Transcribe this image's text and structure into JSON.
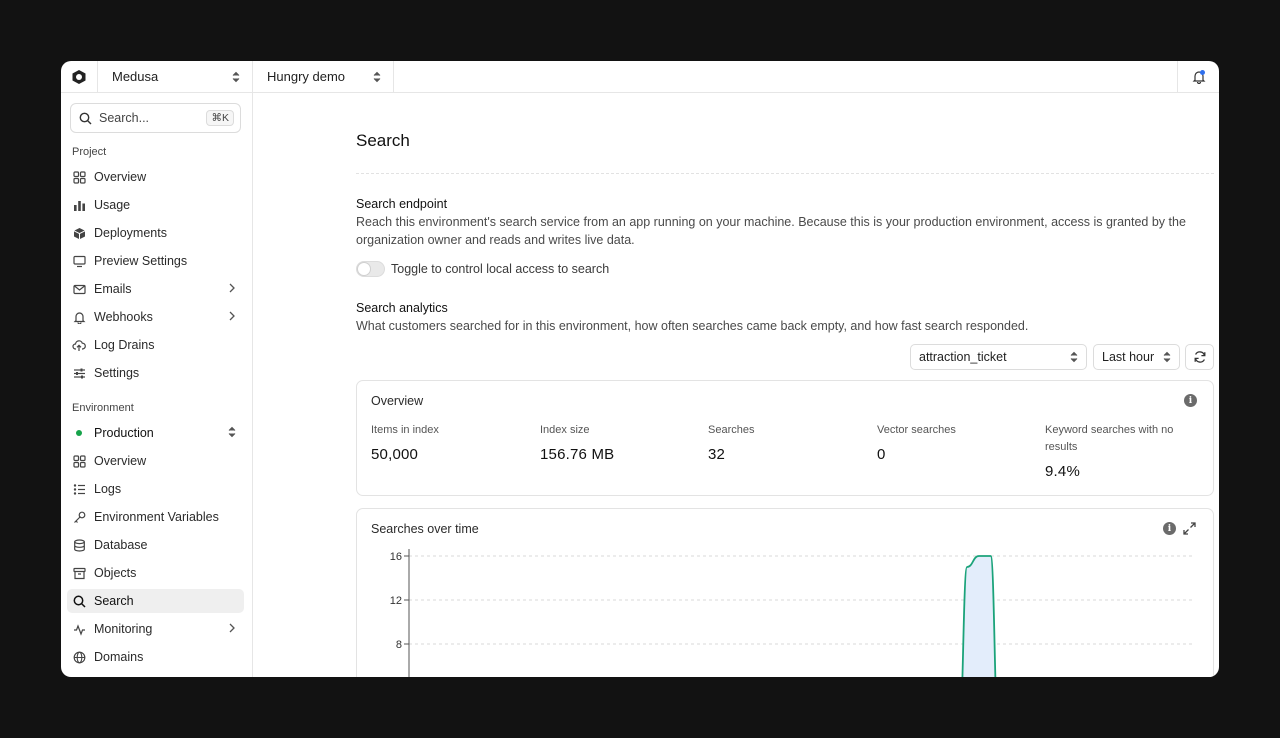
{
  "topbar": {
    "org_name": "Medusa",
    "project_name": "Hungry demo"
  },
  "sidebar": {
    "search_placeholder": "Search...",
    "search_shortcut": "⌘K",
    "project_label": "Project",
    "project_items": [
      {
        "label": "Overview",
        "icon": "grid-icon"
      },
      {
        "label": "Usage",
        "icon": "bar-chart-icon"
      },
      {
        "label": "Deployments",
        "icon": "cube-icon"
      },
      {
        "label": "Preview Settings",
        "icon": "monitor-icon"
      },
      {
        "label": "Emails",
        "icon": "mail-icon",
        "expandable": true
      },
      {
        "label": "Webhooks",
        "icon": "bell-icon",
        "expandable": true
      },
      {
        "label": "Log Drains",
        "icon": "cloud-upload-icon"
      },
      {
        "label": "Settings",
        "icon": "sliders-icon"
      }
    ],
    "environment_label": "Environment",
    "environment_name": "Production",
    "environment_color": "#16a34a",
    "environment_items": [
      {
        "label": "Overview",
        "icon": "grid-icon"
      },
      {
        "label": "Logs",
        "icon": "list-icon"
      },
      {
        "label": "Environment Variables",
        "icon": "key-icon"
      },
      {
        "label": "Database",
        "icon": "database-icon"
      },
      {
        "label": "Objects",
        "icon": "archive-icon"
      },
      {
        "label": "Search",
        "icon": "search-icon",
        "active": true
      },
      {
        "label": "Monitoring",
        "icon": "activity-icon",
        "expandable": true
      },
      {
        "label": "Domains",
        "icon": "globe-icon"
      }
    ]
  },
  "main": {
    "title": "Search",
    "endpoint": {
      "heading": "Search endpoint",
      "description": "Reach this environment's search service from an app running on your machine. Because this is your production environment, access is granted by the organization owner and reads and writes live data.",
      "toggle_label": "Toggle to control local access to search",
      "toggle_on": false
    },
    "analytics": {
      "heading": "Search analytics",
      "description": "What customers searched for in this environment, how often searches came back empty, and how fast search responded.",
      "index_select": "attraction_ticket",
      "range_select": "Last hour"
    },
    "overview": {
      "title": "Overview",
      "stats": [
        {
          "label": "Items in index",
          "value": "50,000"
        },
        {
          "label": "Index size",
          "value": "156.76 MB"
        },
        {
          "label": "Searches",
          "value": "32"
        },
        {
          "label": "Vector searches",
          "value": "0"
        },
        {
          "label": "Keyword searches with no results",
          "value": "9.4%"
        }
      ]
    }
  },
  "chart_data": {
    "type": "area",
    "title": "Searches over time",
    "yticks": [
      8,
      12,
      16
    ],
    "ylim": [
      0,
      16.5
    ],
    "x": [
      0,
      0.69,
      0.7,
      0.71,
      0.725,
      0.74,
      0.75,
      0.76,
      1
    ],
    "values": [
      0,
      0,
      0,
      15,
      16,
      16,
      0,
      0,
      0
    ],
    "line_color": "#1ba37a",
    "fill_color": "#e3edfb",
    "grid": true
  },
  "colors": {
    "accent": "#2f6fed",
    "env_dot": "#16a34a"
  }
}
